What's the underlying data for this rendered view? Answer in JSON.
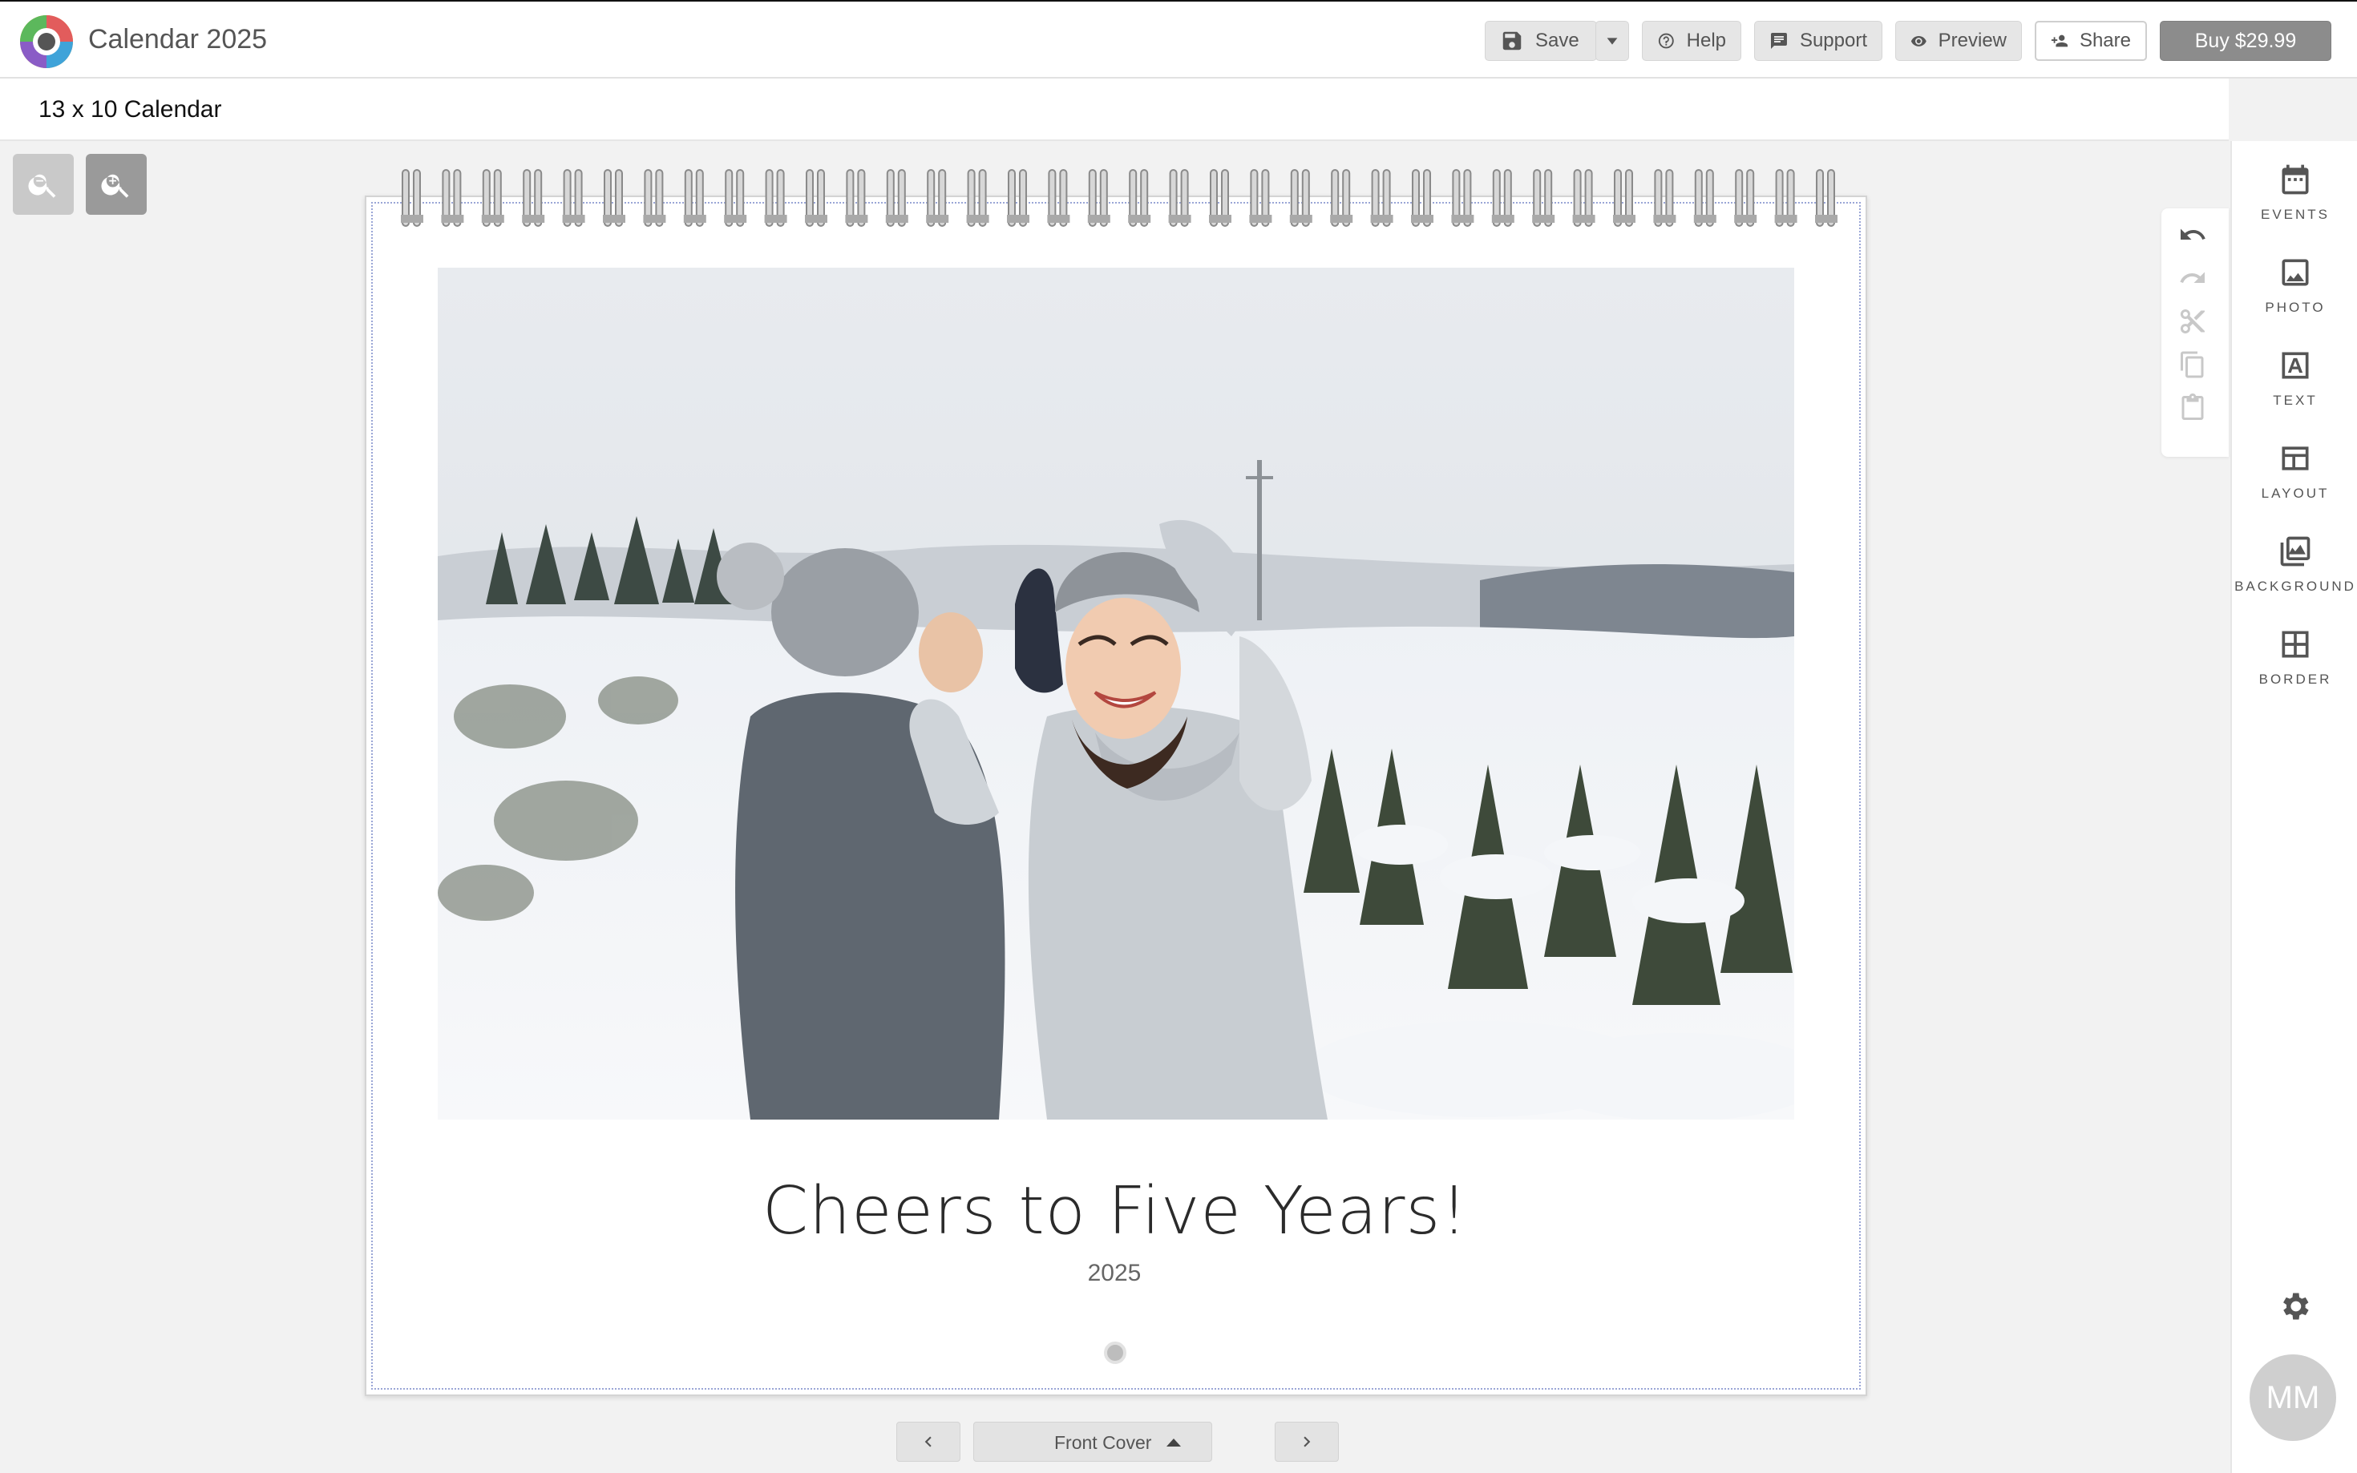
{
  "app": {
    "title": "Calendar 2025"
  },
  "toolbar": {
    "save_label": "Save",
    "help_label": "Help",
    "support_label": "Support",
    "preview_label": "Preview",
    "share_label": "Share",
    "buy_label": "Buy $29.99"
  },
  "subheader": {
    "product_title": "13 x 10 Calendar"
  },
  "canvas": {
    "cover_title": "Cheers to Five Years!",
    "cover_year": "2025"
  },
  "pager": {
    "current_page": "Front Cover"
  },
  "rail": {
    "items": [
      {
        "label": "EVENTS",
        "icon": "calendar-icon"
      },
      {
        "label": "PHOTO",
        "icon": "photo-icon"
      },
      {
        "label": "TEXT",
        "icon": "text-icon"
      },
      {
        "label": "LAYOUT",
        "icon": "layout-icon"
      },
      {
        "label": "BACKGROUND",
        "icon": "background-icon"
      },
      {
        "label": "BORDER",
        "icon": "border-icon"
      }
    ]
  },
  "user": {
    "initials": "MM"
  },
  "colors": {
    "buy_button": "#8c8c8c",
    "page_guide": "#9aa6d6"
  }
}
